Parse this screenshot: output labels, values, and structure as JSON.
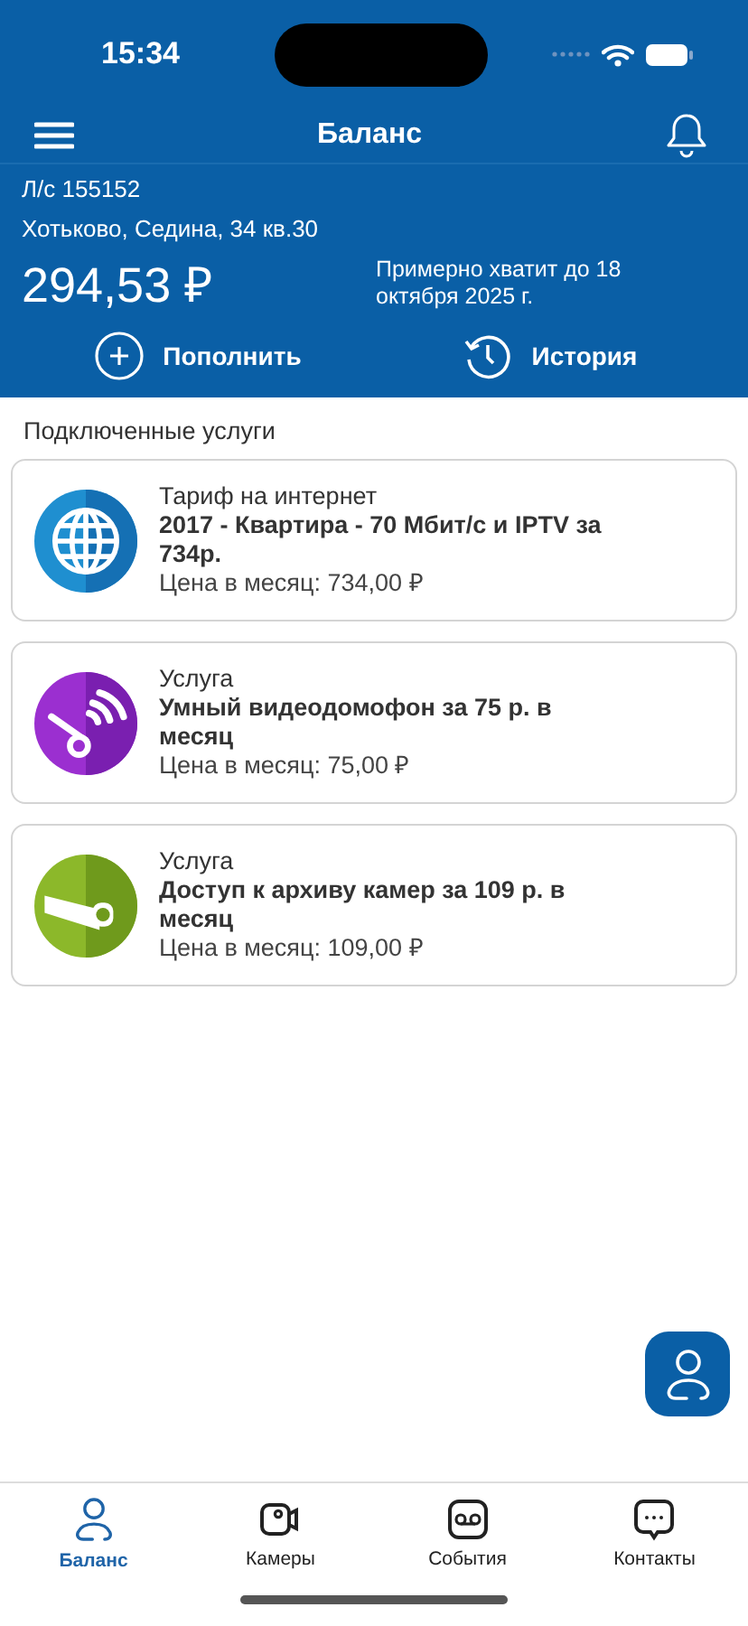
{
  "status_bar": {
    "time": "15:34"
  },
  "header": {
    "title": "Баланс"
  },
  "account": {
    "number": "Л/с 155152",
    "address": "Хотьково, Седина, 34 кв.30",
    "balance": "294,53 ₽",
    "forecast": "Примерно хватит до 18 октября 2025 г."
  },
  "actions": [
    {
      "kind": "topup",
      "label": "Пополнить"
    },
    {
      "kind": "history",
      "label": "История"
    }
  ],
  "services_title": "Подключенные услуги",
  "services": [
    {
      "kind": "internet",
      "category": "Тариф на интернет",
      "name": "2017 - Квартира - 70 Мбит/с и IPTV за 734р.",
      "price": "Цена в месяц: 734,00 ₽"
    },
    {
      "kind": "intercom",
      "category": "Услуга",
      "name": "Умный видеодомофон за 75 р. в месяц",
      "price": "Цена в месяц: 75,00 ₽"
    },
    {
      "kind": "camera",
      "category": "Услуга",
      "name": "Доступ к архиву камер за 109 р. в месяц",
      "price": "Цена в месяц: 109,00 ₽"
    }
  ],
  "tabs": [
    {
      "kind": "balance",
      "label": "Баланс",
      "selected": true
    },
    {
      "kind": "cameras",
      "label": "Камеры",
      "selected": false
    },
    {
      "kind": "events",
      "label": "События",
      "selected": false
    },
    {
      "kind": "contacts",
      "label": "Контакты",
      "selected": false
    }
  ]
}
